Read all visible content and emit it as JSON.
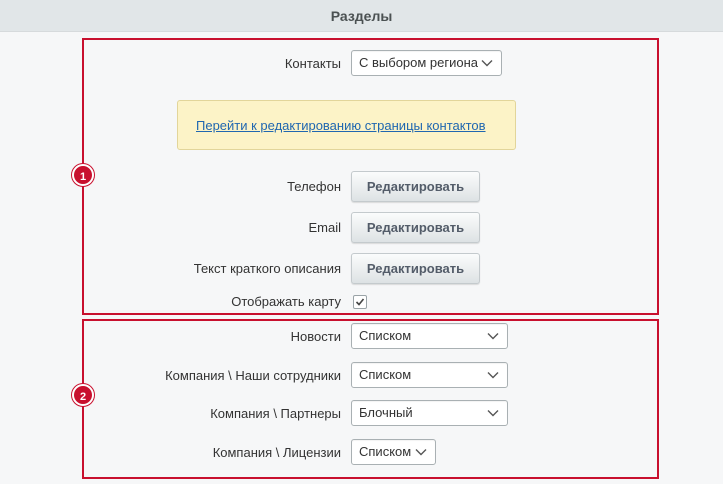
{
  "header": {
    "title": "Разделы"
  },
  "group1": {
    "badge": "1",
    "contacts": {
      "label": "Контакты",
      "value": "С выбором региона"
    },
    "info_link": "Перейти к редактированию страницы контактов",
    "phone": {
      "label": "Телефон",
      "button": "Редактировать"
    },
    "email": {
      "label": "Email",
      "button": "Редактировать"
    },
    "short_desc": {
      "label": "Текст краткого описания",
      "button": "Редактировать"
    },
    "show_map": {
      "label": "Отображать карту",
      "checked": true
    }
  },
  "group2": {
    "badge": "2",
    "news": {
      "label": "Новости",
      "value": "Списком"
    },
    "staff": {
      "label": "Компания \\ Наши сотрудники",
      "value": "Списком"
    },
    "partners": {
      "label": "Компания \\ Партнеры",
      "value": "Блочный"
    },
    "licenses": {
      "label": "Компания \\ Лицензии",
      "value": "Списком"
    }
  },
  "colors": {
    "accent": "#c8102e",
    "link": "#2067b0",
    "info_bg": "#fcf3c7"
  },
  "icons": {
    "select_arrow": "chevron-down-icon",
    "check": "check-icon"
  }
}
